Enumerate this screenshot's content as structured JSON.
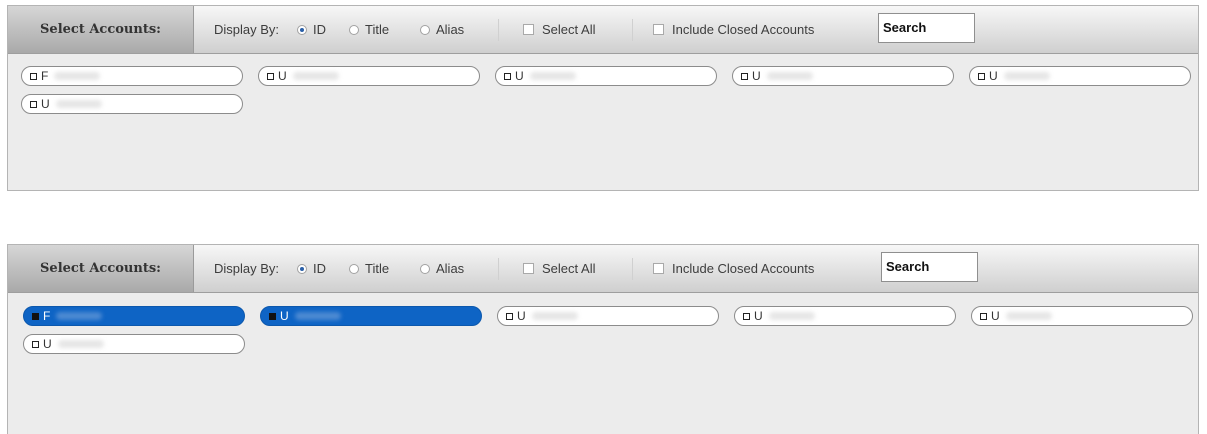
{
  "panels": [
    {
      "header": "Select Accounts:",
      "display_by_label": "Display By:",
      "display_options": [
        {
          "label": "ID",
          "selected": true
        },
        {
          "label": "Title",
          "selected": false
        },
        {
          "label": "Alias",
          "selected": false
        }
      ],
      "select_all_label": "Select All",
      "select_all_checked": false,
      "include_closed_label": "Include Closed Accounts",
      "include_closed_checked": false,
      "search_value": "Search",
      "accounts": [
        {
          "id_prefix": "F",
          "selected": false
        },
        {
          "id_prefix": "U",
          "selected": false
        },
        {
          "id_prefix": "U",
          "selected": false
        },
        {
          "id_prefix": "U",
          "selected": false
        },
        {
          "id_prefix": "U",
          "selected": false
        },
        {
          "id_prefix": "U",
          "selected": false
        }
      ]
    },
    {
      "header": "Select Accounts:",
      "display_by_label": "Display By:",
      "display_options": [
        {
          "label": "ID",
          "selected": true
        },
        {
          "label": "Title",
          "selected": false
        },
        {
          "label": "Alias",
          "selected": false
        }
      ],
      "select_all_label": "Select All",
      "select_all_checked": false,
      "include_closed_label": "Include Closed Accounts",
      "include_closed_checked": false,
      "search_value": "Search",
      "accounts": [
        {
          "id_prefix": "F",
          "selected": true
        },
        {
          "id_prefix": "U",
          "selected": true
        },
        {
          "id_prefix": "U",
          "selected": false
        },
        {
          "id_prefix": "U",
          "selected": false
        },
        {
          "id_prefix": "U",
          "selected": false
        },
        {
          "id_prefix": "U",
          "selected": false
        }
      ]
    }
  ],
  "colors": {
    "selected_pill": "#0e64c5",
    "radio_dot": "#2a5fa8"
  }
}
